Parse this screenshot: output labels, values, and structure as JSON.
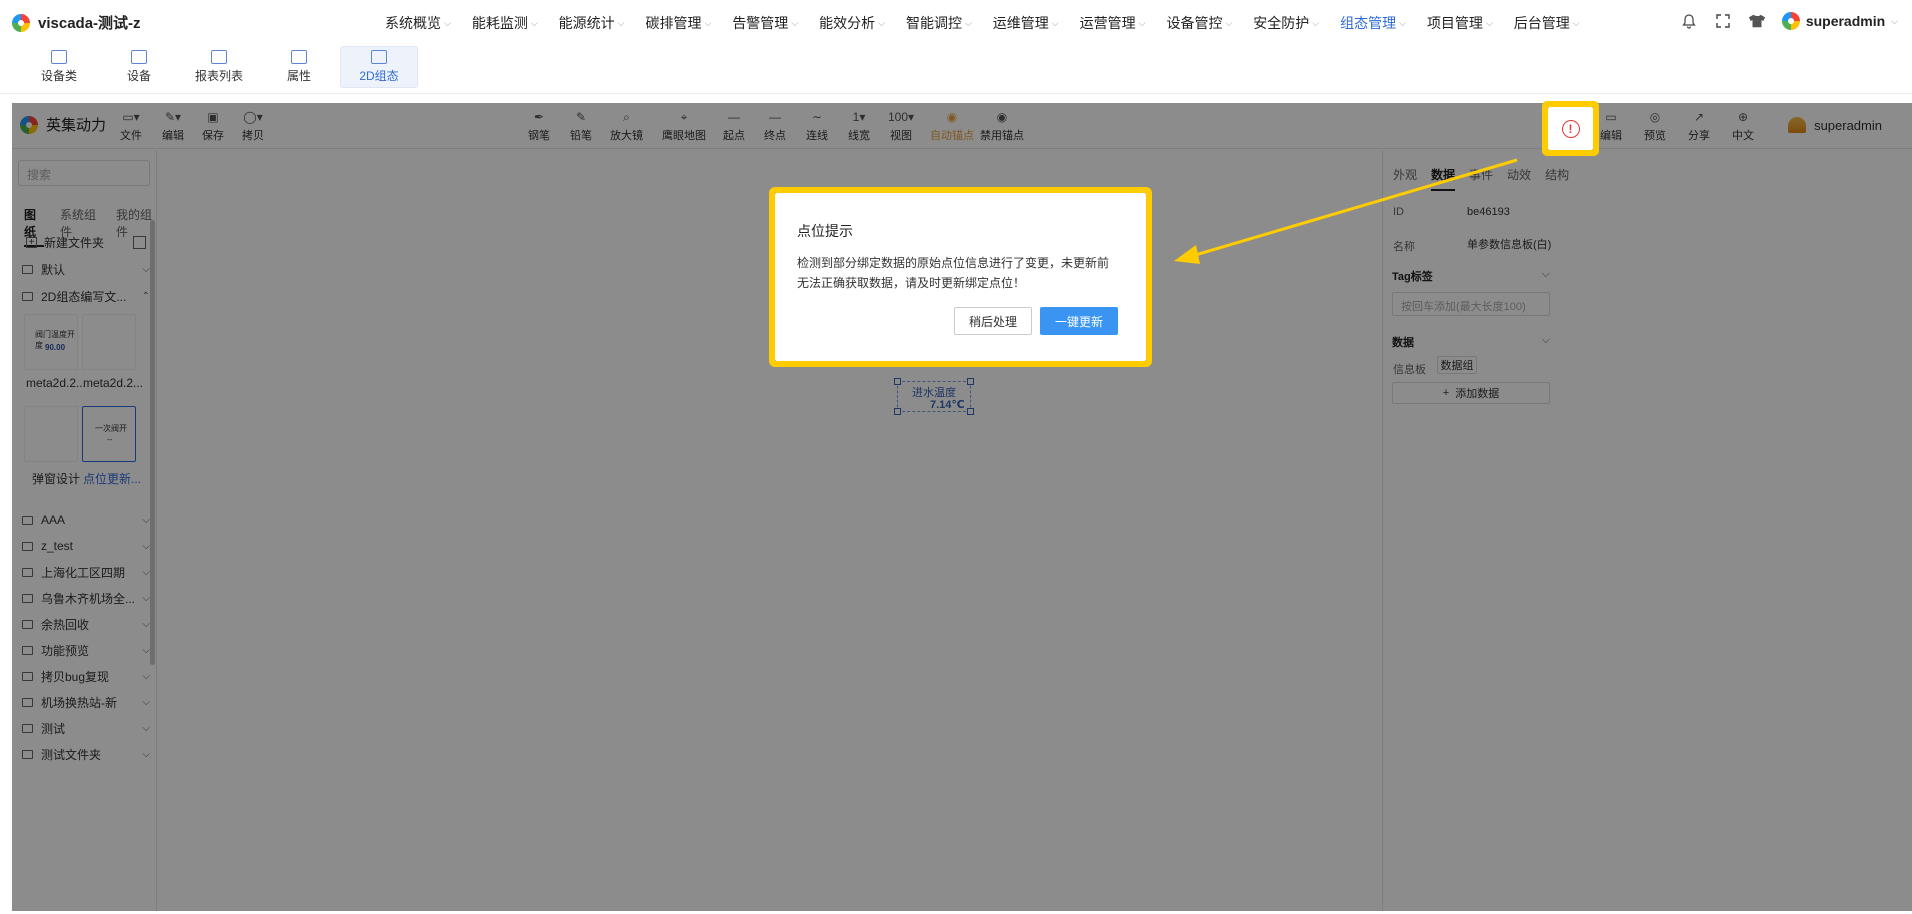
{
  "topnav": {
    "brand": "viscada-测试-z",
    "menu": [
      "系统概览",
      "能耗监测",
      "能源统计",
      "碳排管理",
      "告警管理",
      "能效分析",
      "智能调控",
      "运维管理",
      "运营管理",
      "设备管控",
      "安全防护",
      "组态管理",
      "项目管理",
      "后台管理"
    ],
    "active_menu": "组态管理",
    "user": "superadmin"
  },
  "subnav": {
    "items": [
      "设备类",
      "设备",
      "报表列表",
      "属性",
      "2D组态"
    ],
    "active": "2D组态"
  },
  "toolbar": {
    "brand": "英集动力",
    "left_buttons": [
      "文件",
      "编辑",
      "保存",
      "拷贝"
    ],
    "center_buttons": [
      "钢笔",
      "铅笔",
      "放大镜",
      "鹰眼地图",
      "起点",
      "终点",
      "连线",
      "线宽",
      "视图",
      "自动锚点",
      "禁用锚点"
    ],
    "line_width_value": "1",
    "view_value": "100",
    "right_buttons": [
      "编辑",
      "预览",
      "分享",
      "中文"
    ],
    "user": "superadmin"
  },
  "left_panel": {
    "search_placeholder": "搜索",
    "tabs": [
      "图纸",
      "系统组件",
      "我的组件"
    ],
    "active_tab": "图纸",
    "new_folder": "新建文件夹",
    "folders_top": [
      "默认",
      "2D组态编写文..."
    ],
    "thumbs": [
      {
        "label": "meta2d.2...",
        "content_line1": "阀门温度开度",
        "content_line2": "90.00"
      },
      {
        "label": "meta2d.2..."
      },
      {
        "label": "弹窗设计"
      },
      {
        "label": "点位更新...",
        "content_line1": "一次阀开",
        "content_line2": "--"
      }
    ],
    "folders_bottom": [
      "AAA",
      "z_test",
      "上海化工区四期",
      "乌鲁木齐机场全...",
      "余热回收",
      "功能预览",
      "拷贝bug复现",
      "机场换热站-新",
      "测试",
      "测试文件夹"
    ]
  },
  "canvas": {
    "widget_label": "进水温度",
    "widget_value": "7.14℃"
  },
  "right_panel": {
    "tabs": [
      "外观",
      "数据",
      "事件",
      "动效",
      "结构"
    ],
    "active_tab": "数据",
    "id_label": "ID",
    "id_value": "be46193",
    "name_label": "名称",
    "name_value": "单参数信息板(白)",
    "tag_section": "Tag标签",
    "tag_placeholder": "按回车添加(最大长度100)",
    "data_section": "数据",
    "infoboard_label": "信息板",
    "data_group_button": "数据组",
    "add_data_button": "添加数据"
  },
  "dialog": {
    "title": "点位提示",
    "message": "检测到部分绑定数据的原始点位信息进行了变更，未更新前无法正确获取数据，请及时更新绑定点位！",
    "later_button": "稍后处理",
    "update_button": "一键更新"
  },
  "colors": {
    "accent": "#2f6bd8",
    "primary_button": "#3a95f2",
    "highlight": "#ffcc00",
    "alert": "#e53935",
    "orange_tool": "#e8a33a"
  }
}
